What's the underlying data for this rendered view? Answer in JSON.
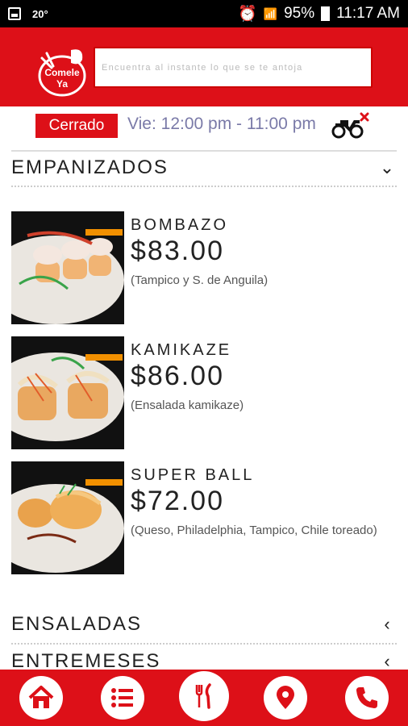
{
  "status_bar": {
    "temperature": "20°",
    "battery": "95%",
    "time": "11:17 AM"
  },
  "header": {
    "logo_text": "Comele Ya",
    "search_placeholder": "Encuentra al instante lo que se te antoja"
  },
  "store_status": {
    "badge": "Cerrado",
    "hours": "Vie: 12:00 pm - 11:00 pm"
  },
  "categories": [
    {
      "name": "EMPANIZADOS",
      "expanded": true
    },
    {
      "name": "ENSALADAS",
      "expanded": false
    },
    {
      "name": "ENTREMESES",
      "expanded": false
    }
  ],
  "items": [
    {
      "name": "BOMBAZO",
      "price": "$83.00",
      "description": "(Tampico y S. de Anguila)"
    },
    {
      "name": "KAMIKAZE",
      "price": "$86.00",
      "description": "(Ensalada kamikaze)"
    },
    {
      "name": "SUPER BALL",
      "price": "$72.00",
      "description": "(Queso, Philadelphia, Tampico, Chile toreado)"
    }
  ],
  "bottom_nav": [
    "home-icon",
    "menu-list-icon",
    "restaurant-icon",
    "location-icon",
    "phone-icon"
  ],
  "colors": {
    "brand_red": "#dd1018",
    "hours_text": "#7a7aa8",
    "tag_orange": "#f29000"
  }
}
